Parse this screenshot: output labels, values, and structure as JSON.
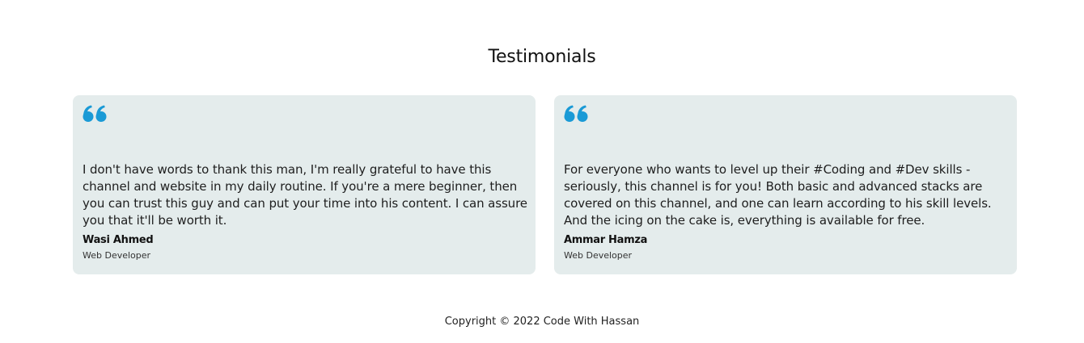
{
  "section": {
    "title": "Testimonials"
  },
  "testimonials": [
    {
      "quote": "I don't have words to thank this man, I'm really grateful to have this channel and website in my daily routine. If you're a mere beginner, then you can trust this guy and can put your time into his content. I can assure you that it'll be worth it.",
      "name": "Wasi Ahmed",
      "role": "Web Developer"
    },
    {
      "quote": "For everyone who wants to level up their #Coding and #Dev skills - seriously, this channel is for you! Both basic and advanced stacks are covered on this channel, and one can learn according to his skill levels. And the icing on the cake is, everything is available for free.",
      "name": "Ammar Hamza",
      "role": "Web Developer"
    }
  ],
  "footer": {
    "copyright": "Copyright © 2022 Code With Hassan"
  },
  "colors": {
    "card_background": "#e4ecec",
    "quote_icon": "#1a9ad6"
  },
  "icons": {
    "quote": "quote-icon"
  }
}
